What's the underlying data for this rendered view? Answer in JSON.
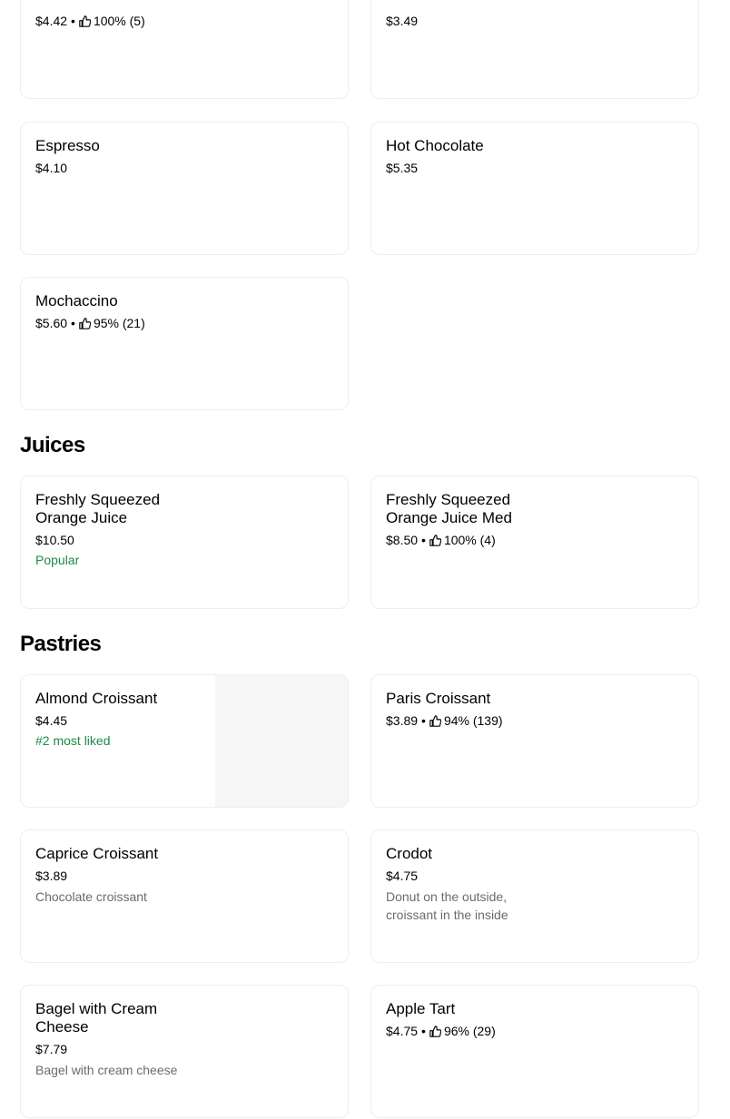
{
  "colors": {
    "accent_green": "#1e8a47",
    "muted_text": "#6b6b6b",
    "card_border": "#eeeeee"
  },
  "coffee_partial": {
    "items": [
      {
        "price": "$4.42",
        "rating": "100% (5)"
      },
      {
        "price": "$3.49"
      }
    ]
  },
  "coffee": {
    "items": [
      {
        "name": "Espresso",
        "price": "$4.10"
      },
      {
        "name": "Hot Chocolate",
        "price": "$5.35"
      },
      {
        "name": "Mochaccino",
        "price": "$5.60",
        "rating": "95% (21)"
      }
    ]
  },
  "juices": {
    "title": "Juices",
    "items": [
      {
        "name": "Freshly Squeezed Orange Juice",
        "price": "$10.50",
        "tag": "Popular"
      },
      {
        "name": "Freshly Squeezed Orange Juice Med",
        "price": "$8.50",
        "rating": "100% (4)"
      }
    ]
  },
  "pastries": {
    "title": "Pastries",
    "items": [
      {
        "name": "Almond Croissant",
        "price": "$4.45",
        "tag": "#2 most liked"
      },
      {
        "name": "Paris Croissant",
        "price": "$3.89",
        "rating": "94% (139)"
      },
      {
        "name": "Caprice Croissant",
        "price": "$3.89",
        "description": "Chocolate croissant"
      },
      {
        "name": "Crodot",
        "price": "$4.75",
        "description": "Donut on the outside, croissant in the inside"
      },
      {
        "name": "Bagel with Cream Cheese",
        "price": "$7.79",
        "description": "Bagel with cream cheese"
      },
      {
        "name": "Apple Tart",
        "price": "$4.75",
        "rating": "96% (29)"
      }
    ]
  },
  "icons": {
    "rating": "thumbs-up-icon",
    "separator": "•"
  }
}
